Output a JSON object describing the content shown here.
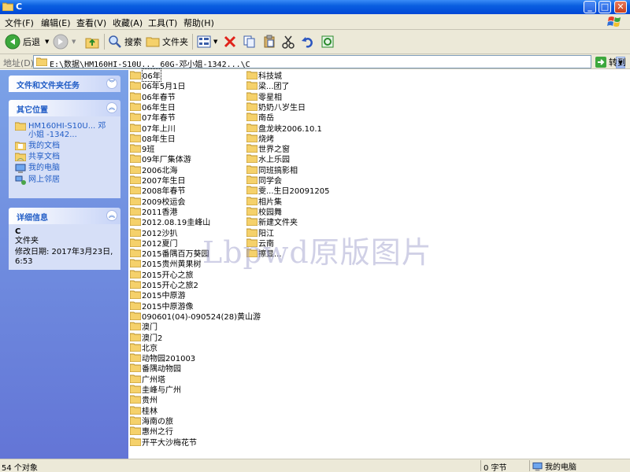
{
  "window": {
    "title": "C"
  },
  "menu": [
    "文件(F)",
    "编辑(E)",
    "查看(V)",
    "收藏(A)",
    "工具(T)",
    "帮助(H)"
  ],
  "toolbar": {
    "back": "后退",
    "search": "搜索",
    "folders": "文件夹"
  },
  "address": {
    "label": "地址(D)",
    "path": "E:\\数据\\HM160HI-S10U... 60G-邓小姐-1342...\\C",
    "go": "转到"
  },
  "tasks": {
    "file_folder_tasks": "文件和文件夹任务",
    "other_places": {
      "title": "其它位置",
      "items": [
        "HM160HI-S10U... 邓小姐 -1342...",
        "我的文档",
        "共享文档",
        "我的电脑",
        "网上邻居"
      ]
    },
    "details": {
      "title": "详细信息",
      "name": "C",
      "type": "文件夹",
      "modified": "修改日期: 2017年3月23日, 6:53"
    }
  },
  "files": {
    "col1": [
      "06年",
      "06年5月1日",
      "06年春节",
      "06年生日",
      "07年春节",
      "07年上川",
      "08年生日",
      "9班",
      "09年厂集体游",
      "2006北海",
      "2007年生日",
      "2008年春节",
      "2009校运会",
      "2011香港",
      "2012.08.19圭峰山",
      "2012沙扒",
      "2012夏门",
      "2015番隅百万葵园",
      "2015贵州黄果树",
      "2015开心之旅",
      "2015开心之旅2",
      "2015中原游",
      "2015中原游像",
      "090601(04)-090524(28)黄山游",
      "澳门",
      "澳门2",
      "北京",
      "动物园201003",
      "番隅动物园",
      "广州塔",
      "圭峰与广州",
      "贵州",
      "桂林",
      "海南の旅",
      "惠州之行",
      "开平大沙梅花节"
    ],
    "col2": [
      "科技城",
      "梁...团了",
      "零星相",
      "奶奶八岁生日",
      "南岳",
      "盘龙峡2006.10.1",
      "烧烤",
      "世界之窗",
      "水上乐园",
      "同班搞影相",
      "同学会",
      "雯...生日20091205",
      "相片集",
      "校园舞",
      "新建文件夹",
      "阳江",
      "云南",
      "擦显..."
    ]
  },
  "watermark": "Lbpwd原版图片",
  "status": {
    "count": "54 个对象",
    "size": "0 字节",
    "location": "我的电脑"
  }
}
